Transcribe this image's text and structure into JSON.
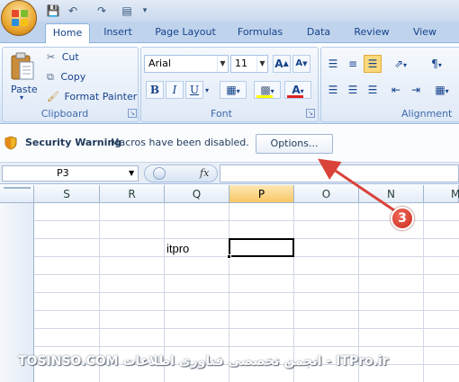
{
  "ribbon": {
    "tabs": [
      "Home",
      "Insert",
      "Page Layout",
      "Formulas",
      "Data",
      "Review",
      "View"
    ],
    "active_tab": "Home",
    "clipboard": {
      "paste_label": "Paste",
      "cut_label": "Cut",
      "copy_label": "Copy",
      "format_painter_label": "Format Painter",
      "group_label": "Clipboard"
    },
    "font": {
      "font_name": "Arial",
      "font_size": "11",
      "bold": "B",
      "italic": "I",
      "underline": "U",
      "grow": "A",
      "shrink": "A",
      "group_label": "Font",
      "font_color": "#e02020",
      "highlight_color": "#ffff00"
    },
    "alignment": {
      "group_label": "Alignment"
    }
  },
  "security_bar": {
    "title": "Security Warning",
    "message": "Macros have been disabled.",
    "options_label": "Options..."
  },
  "formula_bar": {
    "name_box": "P3",
    "fx_label": "fx",
    "value": ""
  },
  "sheet": {
    "columns": [
      "S",
      "R",
      "Q",
      "P",
      "O",
      "N",
      "M"
    ],
    "selected_column": "P",
    "cell_q_text": "itpro",
    "active_cell": "P3"
  },
  "annotation": {
    "number": "3",
    "color": "#d9433a"
  },
  "watermark": {
    "text": "TOSINSO.COM انجمن تخصصی فناوری اطلاعات - ITPro.ir"
  },
  "colors": {
    "ribbon_blue": "#bfd3ec",
    "selected_header": "#f9c765",
    "accent_text": "#15428b"
  }
}
